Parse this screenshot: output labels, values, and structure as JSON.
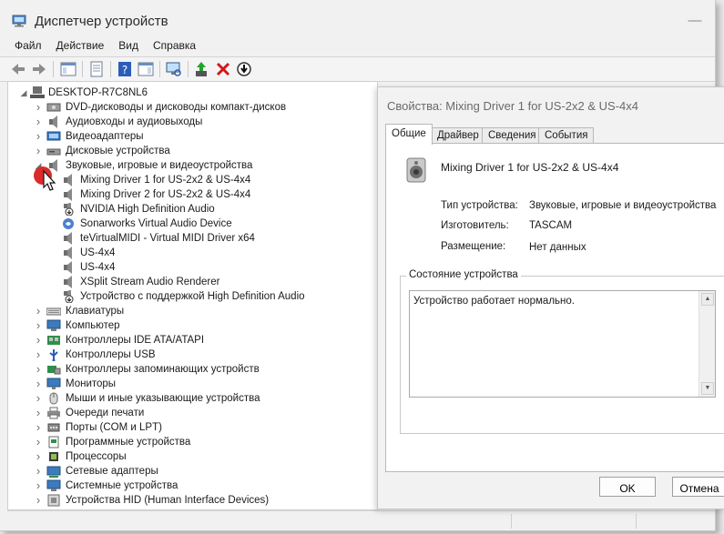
{
  "window": {
    "title": "Диспетчер устройств",
    "controls": {
      "minimize": "—",
      "maximize": "☐",
      "close": "✕"
    }
  },
  "menu": [
    "Файл",
    "Действие",
    "Вид",
    "Справка"
  ],
  "tree": {
    "root": "DESKTOP-R7C8NL6",
    "categories": [
      {
        "label": "DVD-дисководы и дисководы компакт-дисков",
        "icon": "dvd-drive-icon"
      },
      {
        "label": "Аудиовходы и аудиовыходы",
        "icon": "speaker-icon"
      },
      {
        "label": "Видеоадаптеры",
        "icon": "display-adapter-icon"
      },
      {
        "label": "Дисковые устройства",
        "icon": "disk-drive-icon"
      },
      {
        "label": "Звуковые, игровые и видеоустройства",
        "icon": "speaker-icon",
        "expanded": true,
        "children": [
          {
            "label": "Mixing Driver 1 for US-2x2 & US-4x4",
            "icon": "speaker-icon"
          },
          {
            "label": "Mixing Driver 2 for US-2x2 & US-4x4",
            "icon": "speaker-icon"
          },
          {
            "label": "NVIDIA High Definition Audio",
            "icon": "speaker-arrow-icon"
          },
          {
            "label": "Sonarworks Virtual Audio Device",
            "icon": "sonarworks-icon"
          },
          {
            "label": "teVirtualMIDI - Virtual MIDI Driver x64",
            "icon": "speaker-icon"
          },
          {
            "label": "US-4x4",
            "icon": "speaker-icon"
          },
          {
            "label": "US-4x4",
            "icon": "speaker-icon"
          },
          {
            "label": "XSplit  Stream  Audio  Renderer",
            "icon": "speaker-icon"
          },
          {
            "label": "Устройство с поддержкой High Definition Audio",
            "icon": "speaker-arrow-icon"
          }
        ]
      },
      {
        "label": "Клавиатуры",
        "icon": "keyboard-icon"
      },
      {
        "label": "Компьютер",
        "icon": "computer-icon"
      },
      {
        "label": "Контроллеры IDE ATA/ATAPI",
        "icon": "ide-controller-icon"
      },
      {
        "label": "Контроллеры USB",
        "icon": "usb-icon"
      },
      {
        "label": "Контроллеры запоминающих устройств",
        "icon": "storage-controller-icon"
      },
      {
        "label": "Мониторы",
        "icon": "monitor-icon"
      },
      {
        "label": "Мыши и иные указывающие устройства",
        "icon": "mouse-icon"
      },
      {
        "label": "Очереди печати",
        "icon": "printer-icon"
      },
      {
        "label": "Порты (COM и LPT)",
        "icon": "port-icon"
      },
      {
        "label": "Программные устройства",
        "icon": "software-device-icon"
      },
      {
        "label": "Процессоры",
        "icon": "processor-icon"
      },
      {
        "label": "Сетевые адаптеры",
        "icon": "network-adapter-icon"
      },
      {
        "label": "Системные устройства",
        "icon": "system-device-icon"
      },
      {
        "label": "Устройства HID (Human Interface Devices)",
        "icon": "hid-icon"
      }
    ]
  },
  "dialog": {
    "title": "Свойства: Mixing Driver 1 for US-2x2 & US-4x4",
    "tabs": [
      "Общие",
      "Драйвер",
      "Сведения",
      "События"
    ],
    "active_tab": "Общие",
    "device_name": "Mixing Driver 1 for US-2x2 & US-4x4",
    "properties": [
      {
        "key": "Тип устройства:",
        "value": "Звуковые, игровые и видеоустройства"
      },
      {
        "key": "Изготовитель:",
        "value": "TASCAM"
      },
      {
        "key": "Размещение:",
        "value": "Нет данных"
      }
    ],
    "status_group_label": "Состояние устройства",
    "status_text": "Устройство работает нормально.",
    "ok_label": "OK",
    "cancel_label": "Отмена"
  },
  "colors": {
    "accent_green": "#22a32a",
    "delete_red": "#d41818",
    "help_blue": "#2a5db8",
    "cursor_marker": "#d92b2b"
  }
}
